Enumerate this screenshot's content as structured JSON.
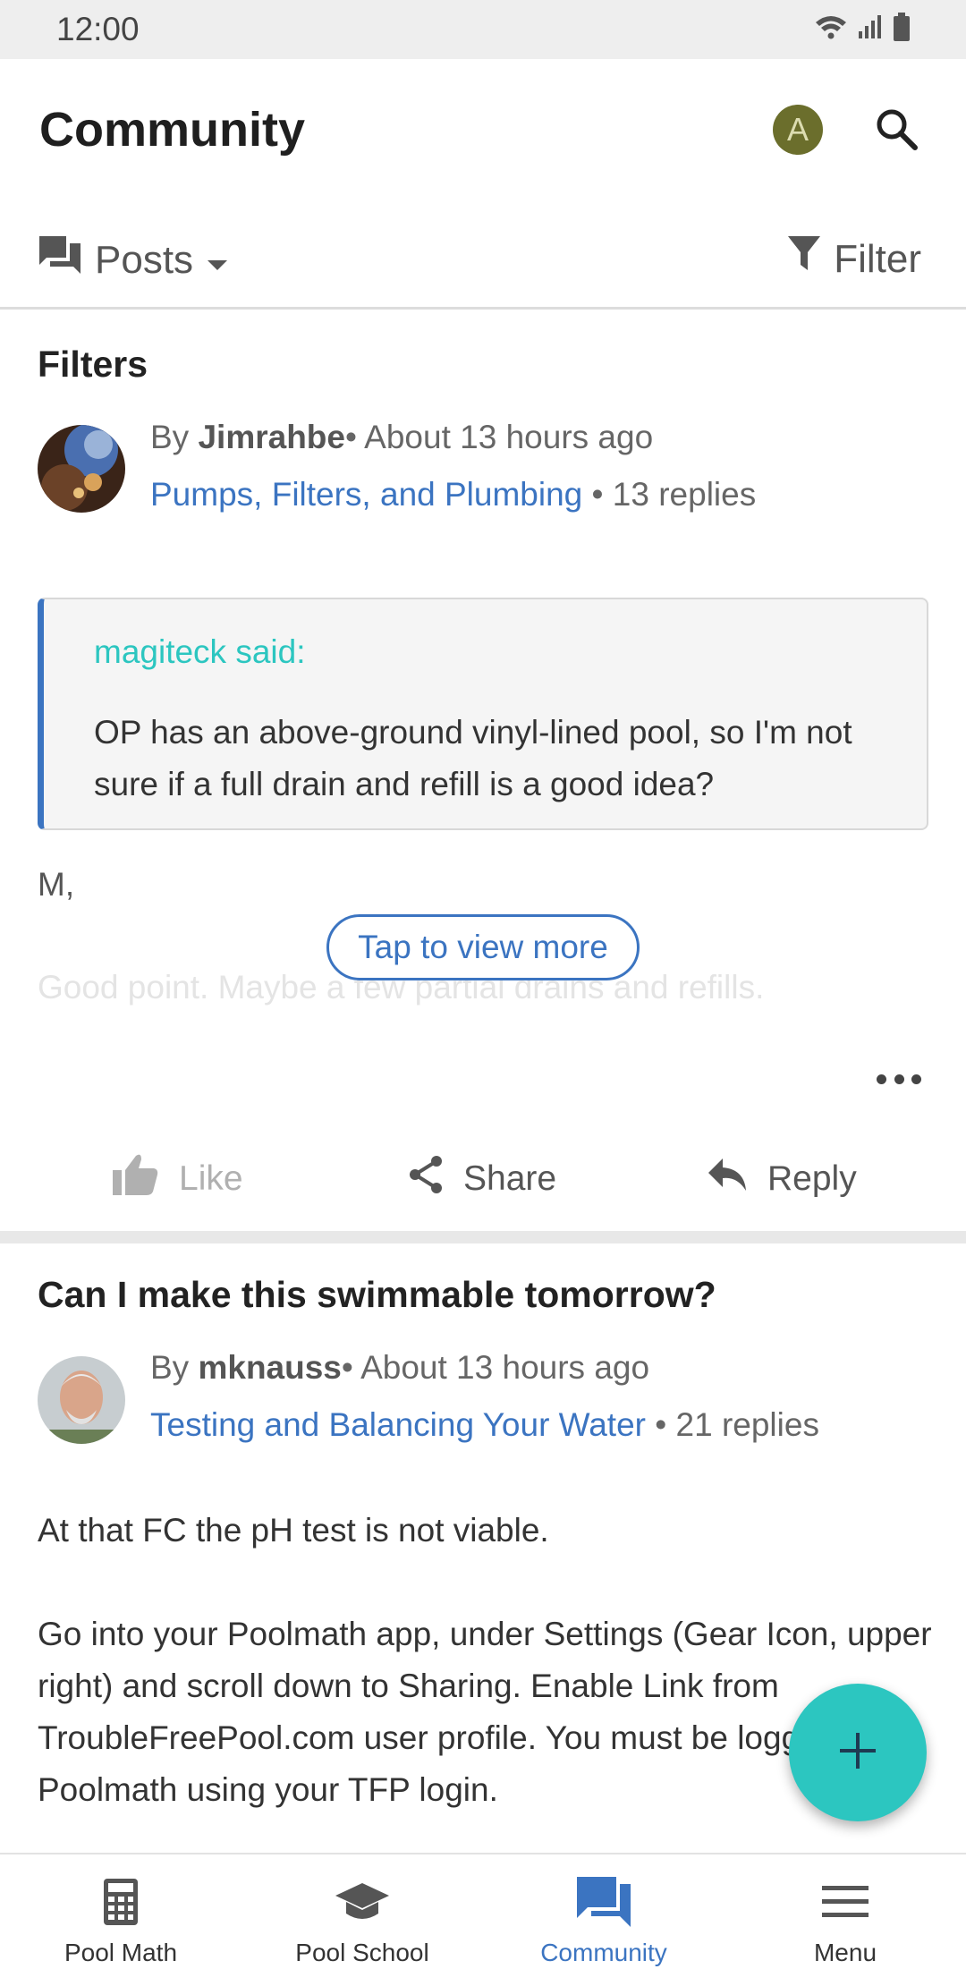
{
  "status_bar": {
    "time": "12:00"
  },
  "header": {
    "title": "Community",
    "avatar_letter": "A"
  },
  "toolbar": {
    "posts_label": "Posts",
    "filter_label": "Filter"
  },
  "posts": [
    {
      "title": "Filters",
      "by_prefix": "By",
      "author": "Jimrahbe",
      "time": "• About 13 hours ago",
      "forum": "Pumps, Filters, and Plumbing",
      "replies": "• 13 replies",
      "quote_author": "magiteck said:",
      "quote_text": "OP has an above-ground vinyl-lined pool, so I'm not sure if a full drain and refill is a good idea?",
      "body_first": "M,",
      "body_faded": "Good point. Maybe a few partial drains and refills.",
      "tap_more": "Tap to view more",
      "actions": {
        "like": "Like",
        "share": "Share",
        "reply": "Reply"
      }
    },
    {
      "title": "Can I make this swimmable tomorrow?",
      "by_prefix": "By",
      "author": "mknauss",
      "time": "• About 13 hours ago",
      "forum": "Testing and Balancing Your Water",
      "replies": "• 21 replies",
      "body_p1": "At that FC the pH test is not viable.",
      "body_p2": "Go into your Poolmath app, under Settings (Gear Icon, upper right) and scroll down to Sharing. Enable Link from TroubleFreePool.com user profile. You must be logged into Poolmath using your TFP login."
    }
  ],
  "bottom_nav": [
    {
      "label": "Pool Math",
      "icon": "calculator-icon"
    },
    {
      "label": "Pool School",
      "icon": "graduation-cap-icon"
    },
    {
      "label": "Community",
      "icon": "chat-icon",
      "active": true
    },
    {
      "label": "Menu",
      "icon": "menu-icon"
    }
  ],
  "colors": {
    "accent": "#3b74c1",
    "fab": "#2cc6c0",
    "quote_author": "#2cc6c0",
    "avatar": "#6b6e2c"
  }
}
